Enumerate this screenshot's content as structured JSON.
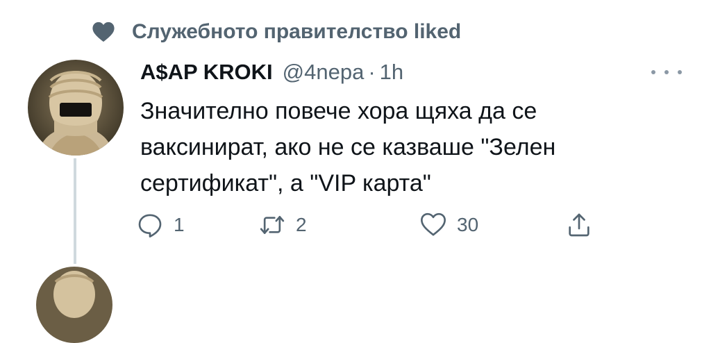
{
  "social_context": {
    "icon": "heart-fill-icon",
    "text": "Служебното правителство liked"
  },
  "tweet": {
    "display_name": "A$AP KROKI",
    "handle": "@4nepa",
    "separator": "·",
    "time": "1h",
    "text_lines": [
      "Значително повече хора щяха да се",
      "ваксинират, ако не се казваше \"Зелен",
      "сертификат\", а \"VIP карта\""
    ],
    "actions": {
      "reply_count": "1",
      "retweet_count": "2",
      "like_count": "30"
    }
  },
  "colors": {
    "secondary_text": "#536471",
    "primary_text": "#0f1419",
    "thread_line": "#cfd9de",
    "liked_heart": "#536471"
  }
}
